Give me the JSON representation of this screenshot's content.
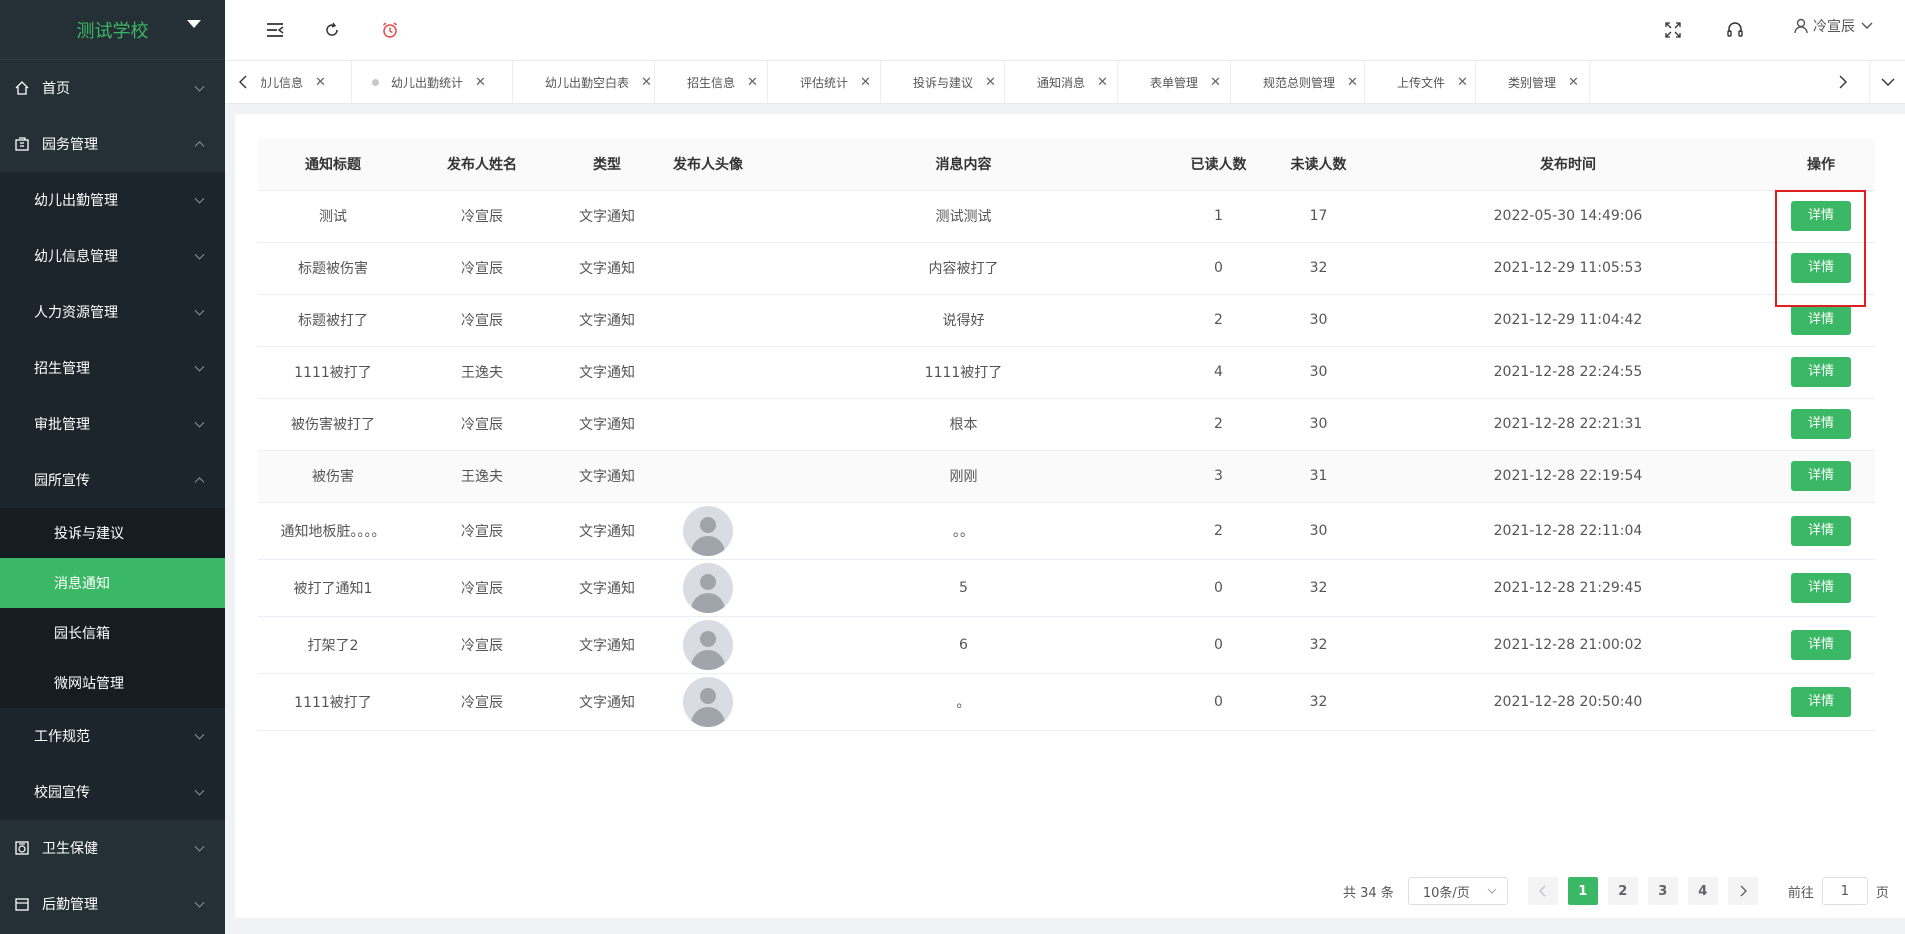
{
  "sidebar": {
    "logo": "测试学校",
    "items": [
      {
        "label": "首页"
      },
      {
        "label": "园务管理"
      },
      {
        "label": "幼儿出勤管理"
      },
      {
        "label": "幼儿信息管理"
      },
      {
        "label": "人力资源管理"
      },
      {
        "label": "招生管理"
      },
      {
        "label": "审批管理"
      },
      {
        "label": "园所宣传"
      },
      {
        "label": "投诉与建议"
      },
      {
        "label": "消息通知"
      },
      {
        "label": "园长信箱"
      },
      {
        "label": "微网站管理"
      },
      {
        "label": "工作规范"
      },
      {
        "label": "校园宣传"
      },
      {
        "label": "卫生保健"
      },
      {
        "label": "后勤管理"
      }
    ]
  },
  "header": {
    "user_name": "冷宣辰"
  },
  "tabs": [
    {
      "label": "幼儿信息"
    },
    {
      "label": "幼儿出勤统计"
    },
    {
      "label": "幼儿出勤空白表"
    },
    {
      "label": "招生信息"
    },
    {
      "label": "评估统计"
    },
    {
      "label": "投诉与建议"
    },
    {
      "label": "通知消息"
    },
    {
      "label": "表单管理"
    },
    {
      "label": "规范总则管理"
    },
    {
      "label": "上传文件"
    },
    {
      "label": "类别管理"
    }
  ],
  "table": {
    "headers": [
      "通知标题",
      "发布人姓名",
      "类型",
      "发布人头像",
      "消息内容",
      "已读人数",
      "未读人数",
      "发布时间",
      "操作"
    ],
    "detail_label": "详情",
    "rows": [
      {
        "title": "测试",
        "publisher": "冷宣辰",
        "type": "文字通知",
        "content": "测试测试",
        "read": "1",
        "unread": "17",
        "time": "2022-05-30 14:49:06"
      },
      {
        "title": "标题被伤害",
        "publisher": "冷宣辰",
        "type": "文字通知",
        "content": "内容被打了",
        "read": "0",
        "unread": "32",
        "time": "2021-12-29 11:05:53"
      },
      {
        "title": "标题被打了",
        "publisher": "冷宣辰",
        "type": "文字通知",
        "content": "说得好",
        "read": "2",
        "unread": "30",
        "time": "2021-12-29 11:04:42"
      },
      {
        "title": "1111被打了",
        "publisher": "王逸夫",
        "type": "文字通知",
        "content": "1111被打了",
        "read": "4",
        "unread": "30",
        "time": "2021-12-28 22:24:55"
      },
      {
        "title": "被伤害被打了",
        "publisher": "冷宣辰",
        "type": "文字通知",
        "content": "根本",
        "read": "2",
        "unread": "30",
        "time": "2021-12-28 22:21:31"
      },
      {
        "title": "被伤害",
        "publisher": "王逸夫",
        "type": "文字通知",
        "content": "刚刚",
        "read": "3",
        "unread": "31",
        "time": "2021-12-28 22:19:54"
      },
      {
        "title": "通知地板脏。。。。",
        "publisher": "冷宣辰",
        "type": "文字通知",
        "content": "。。",
        "read": "2",
        "unread": "30",
        "time": "2021-12-28 22:11:04"
      },
      {
        "title": "被打了通知1",
        "publisher": "冷宣辰",
        "type": "文字通知",
        "content": "5",
        "read": "0",
        "unread": "32",
        "time": "2021-12-28 21:29:45"
      },
      {
        "title": "打架了2",
        "publisher": "冷宣辰",
        "type": "文字通知",
        "content": "6",
        "read": "0",
        "unread": "32",
        "time": "2021-12-28 21:00:02"
      },
      {
        "title": "1111被打了",
        "publisher": "冷宣辰",
        "type": "文字通知",
        "content": "。",
        "read": "0",
        "unread": "32",
        "time": "2021-12-28 20:50:40"
      }
    ]
  },
  "pagination": {
    "total": "共 34 条",
    "page_size": "10条/页",
    "pages": [
      "1",
      "2",
      "3",
      "4"
    ],
    "goto_prefix": "前往",
    "goto_value": "1",
    "goto_suffix": "页"
  },
  "colors": {
    "accent": "#3bb865",
    "sidebar_bg": "#243036",
    "highlight_box": "#e02020"
  }
}
